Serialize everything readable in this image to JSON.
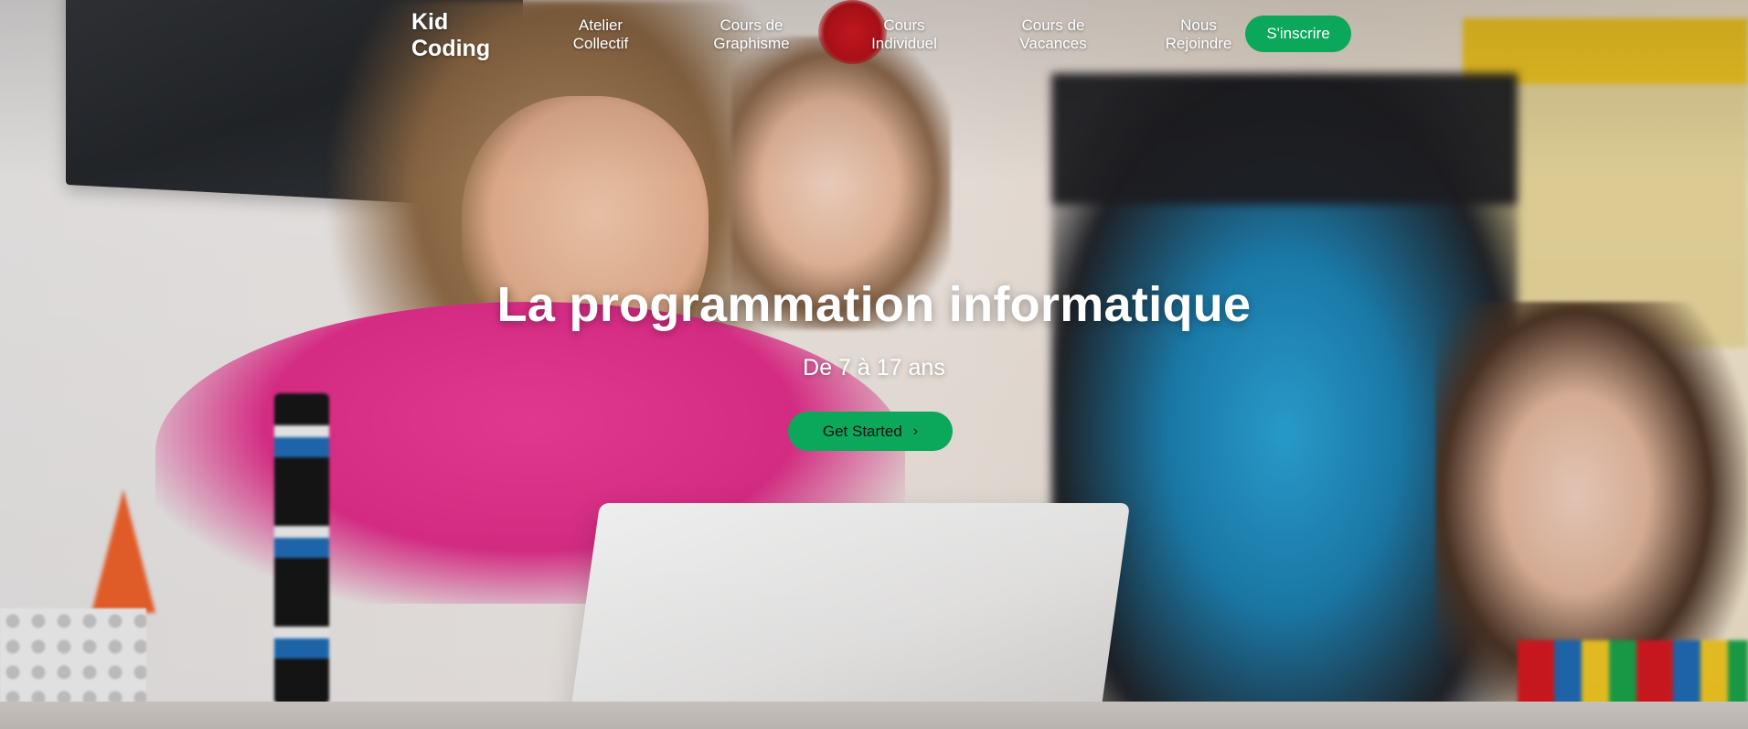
{
  "nav": {
    "logo_line1": "Kid",
    "logo_line2": "Coding",
    "links": [
      {
        "label": "Atelier\nCollectif"
      },
      {
        "label": "Cours de\nGraphisme"
      },
      {
        "label": "Cours\nIndividuel"
      },
      {
        "label": "Cours de\nVacances"
      },
      {
        "label": "Nous\nRejoindre"
      }
    ],
    "cta_label": "S'inscrire"
  },
  "hero": {
    "title": "La programmation informatique",
    "subtitle": "De 7 à 17 ans",
    "button_label": "Get Started",
    "button_icon": "chevron-right-icon"
  },
  "colors": {
    "accent": "#0ba75a",
    "text_light": "#ffffff"
  }
}
